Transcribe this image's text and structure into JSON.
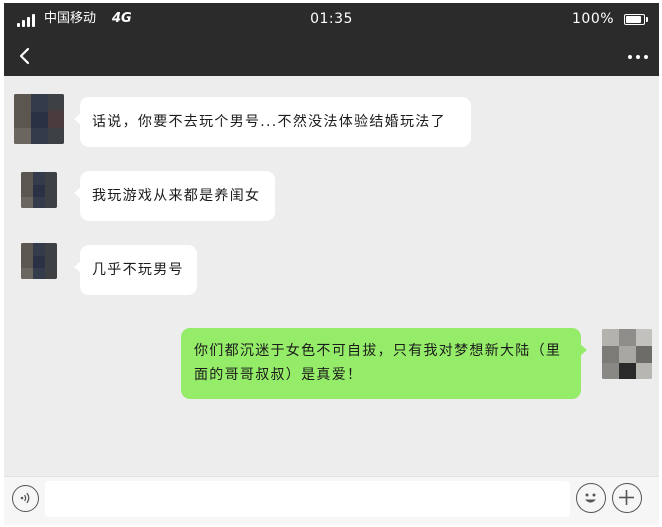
{
  "status_bar": {
    "carrier": "中国移动",
    "network": "4G",
    "time": "01:35",
    "battery_percent": "100%"
  },
  "nav_bar": {
    "back_icon": "chevron-left-icon",
    "more_icon": "ellipsis-icon"
  },
  "messages": [
    {
      "direction": "incoming",
      "text": "话说，你要不去玩个男号...不然没法体验结婚玩法了"
    },
    {
      "direction": "incoming",
      "text": "我玩游戏从来都是养闺女"
    },
    {
      "direction": "incoming",
      "text": "几乎不玩男号"
    },
    {
      "direction": "outgoing",
      "text": "你们都沉迷于女色不可自拔，只有我对梦想新大陆（里面的哥哥叔叔）是真爱！"
    }
  ],
  "input_bar": {
    "input_value": "",
    "voice_icon": "voice-icon",
    "emoji_icon": "emoji-icon",
    "plus_icon": "plus-icon"
  },
  "colors": {
    "top_bar": "#2b2b2b",
    "chat_background": "#ededed",
    "incoming_bubble": "#ffffff",
    "outgoing_bubble": "#95ec69",
    "input_bar": "#f6f6f6"
  }
}
